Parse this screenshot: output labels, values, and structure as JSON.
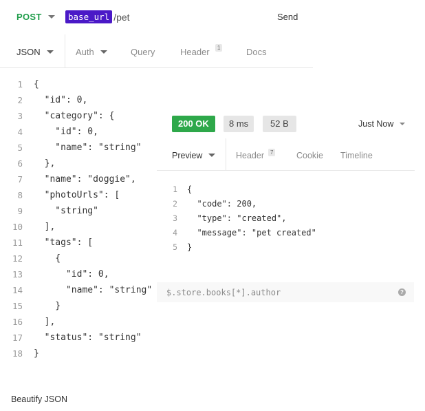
{
  "request": {
    "method": "POST",
    "url_variable": "base_url",
    "url_path": "/pet",
    "send_label": "Send"
  },
  "request_tabs": {
    "body_format": "JSON",
    "auth": "Auth",
    "query": "Query",
    "header": "Header",
    "header_count": "1",
    "docs": "Docs"
  },
  "request_body": {
    "line_numbers": [
      "1",
      "2",
      "3",
      "4",
      "5",
      "6",
      "7",
      "8",
      "9",
      "10",
      "11",
      "12",
      "13",
      "14",
      "15",
      "16",
      "17",
      "18"
    ],
    "lines": [
      "{",
      "  \"id\": 0,",
      "  \"category\": {",
      "    \"id\": 0,",
      "    \"name\": \"string\"",
      "  },",
      "  \"name\": \"doggie\",",
      "  \"photoUrls\": [",
      "    \"string\"",
      "  ],",
      "  \"tags\": [",
      "    {",
      "      \"id\": 0,",
      "      \"name\": \"string\"",
      "    }",
      "  ],",
      "  \"status\": \"string\"",
      "}"
    ]
  },
  "response": {
    "status": "200 OK",
    "time": "8 ms",
    "size": "52 B",
    "history_label": "Just Now",
    "colors": {
      "status_ok": "#2ea84a",
      "url_variable": "#4a19c7",
      "method": "#1f9d4a"
    }
  },
  "response_tabs": {
    "preview": "Preview",
    "header": "Header",
    "header_count": "7",
    "cookie": "Cookie",
    "timeline": "Timeline"
  },
  "response_body": {
    "line_numbers": [
      "1",
      "2",
      "3",
      "4",
      "5"
    ],
    "lines": [
      "{",
      "  \"code\": 200,",
      "  \"type\": \"created\",",
      "  \"message\": \"pet created\"",
      "}"
    ]
  },
  "filter": {
    "placeholder": "$.store.books[*].author",
    "help_icon": "question-circle-icon"
  },
  "footer": {
    "beautify_label": "Beautify JSON"
  }
}
